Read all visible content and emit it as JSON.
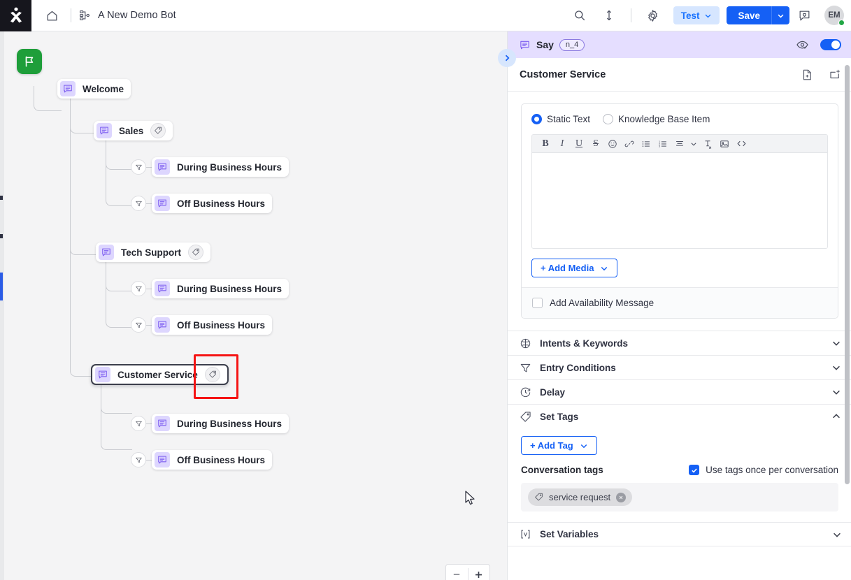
{
  "topbar": {
    "logo": "brand-logo",
    "home_icon": "home-icon",
    "flow_icon": "flow-tree-icon",
    "bot_title": "A New Demo Bot",
    "search_icon": "search-icon",
    "resize_icon": "vertical-resize-icon",
    "settings_icon": "gear-icon",
    "test_label": "Test",
    "save_label": "Save",
    "feedback_icon": "feedback-heart-icon",
    "avatar_initials": "EM",
    "accent_blue": "#1560f5",
    "test_bg": "#d6e6ff",
    "status_dot": "#22a745"
  },
  "canvas": {
    "start_icon": "flag-icon",
    "zoom_out": "minus-icon",
    "zoom_in": "plus-icon",
    "collapse_icon": "chevron-right-icon",
    "nodes": [
      {
        "label": "Welcome",
        "has_tag": false,
        "selected": false
      },
      {
        "label": "Sales",
        "has_tag": true,
        "selected": false
      },
      {
        "label": "During Business Hours",
        "has_tag": false,
        "selected": false
      },
      {
        "label": "Off Business Hours",
        "has_tag": false,
        "selected": false
      },
      {
        "label": "Tech Support",
        "has_tag": true,
        "selected": false
      },
      {
        "label": "During Business Hours",
        "has_tag": false,
        "selected": false
      },
      {
        "label": "Off Business Hours",
        "has_tag": false,
        "selected": false
      },
      {
        "label": "Customer Service",
        "has_tag": true,
        "selected": true
      },
      {
        "label": "During Business Hours",
        "has_tag": false,
        "selected": false
      },
      {
        "label": "Off Business Hours",
        "has_tag": false,
        "selected": false
      }
    ],
    "highlight_color": "#f51414"
  },
  "panel": {
    "header": {
      "node_type": "Say",
      "badge": "n_4",
      "preview_icon": "eye-check-icon",
      "enabled": true
    },
    "subheader": {
      "node_name": "Customer Service",
      "duplicate_icon": "file-plus-icon",
      "move_icon": "move-to-icon"
    },
    "content": {
      "radio_static": "Static Text",
      "radio_kb": "Knowledge Base Item",
      "selected_radio": "Static Text",
      "editor_value": "",
      "toolbar_tools": [
        "bold-icon",
        "italic-icon",
        "underline-icon",
        "strikethrough-icon",
        "emoji-icon",
        "link-icon",
        "bullet-list-icon",
        "numbered-list-icon",
        "align-icon",
        "chevron-down-icon",
        "clear-format-icon",
        "image-icon",
        "code-icon"
      ],
      "add_media_label": "+ Add Media",
      "availability_label": "Add Availability Message",
      "availability_checked": false
    },
    "sections": [
      {
        "label": "Intents & Keywords",
        "icon": "brain-icon",
        "expanded": false
      },
      {
        "label": "Entry Conditions",
        "icon": "funnel-icon",
        "expanded": false
      },
      {
        "label": "Delay",
        "icon": "clock-icon",
        "expanded": false
      },
      {
        "label": "Set Tags",
        "icon": "tag-icon",
        "expanded": true
      }
    ],
    "set_tags": {
      "add_tag_label": "+ Add Tag",
      "conversation_tags_label": "Conversation tags",
      "use_once_label": "Use tags once per conversation",
      "use_once_checked": true,
      "tags": [
        {
          "name": "service request",
          "remove_icon": "close-circle-icon"
        }
      ]
    },
    "set_variables": {
      "label": "Set Variables",
      "icon": "variable-icon",
      "expanded": false
    }
  }
}
